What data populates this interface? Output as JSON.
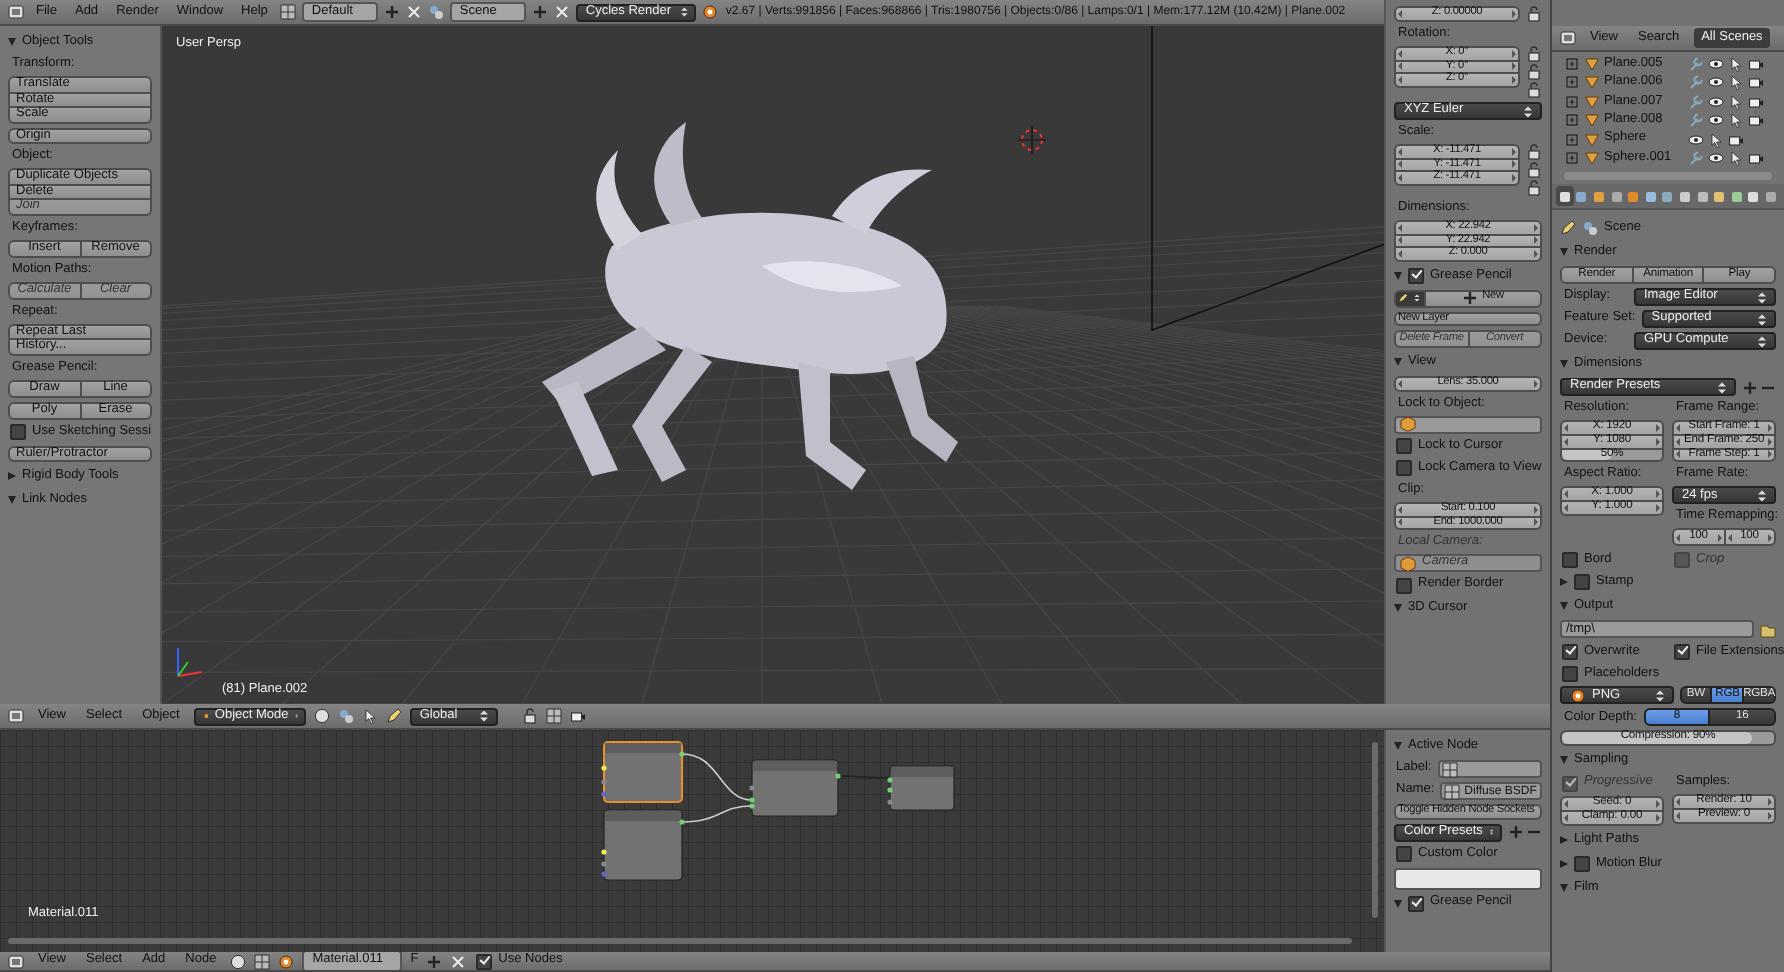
{
  "info_header": {
    "menus": [
      "File",
      "Add",
      "Render",
      "Window",
      "Help"
    ],
    "layout": "Default",
    "scene": "Scene",
    "engine": "Cycles Render",
    "stats": "v2.67 | Verts:991856 | Faces:968866 | Tris:1980756 | Objects:0/86 | Lamps:0/1 | Mem:177.12M (10.42M) | Plane.002"
  },
  "tool_shelf": [
    {
      "kind": "heading",
      "text": "Object Tools",
      "expanded": true
    },
    {
      "kind": "label",
      "text": "Transform:"
    },
    {
      "kind": "stack",
      "items": [
        {
          "kind": "button",
          "text": "Translate"
        },
        {
          "kind": "button",
          "text": "Rotate"
        },
        {
          "kind": "button",
          "text": "Scale"
        }
      ]
    },
    {
      "kind": "stack",
      "items": [
        {
          "kind": "button",
          "text": "Origin"
        }
      ]
    },
    {
      "kind": "label",
      "text": "Object:"
    },
    {
      "kind": "stack",
      "items": [
        {
          "kind": "button",
          "text": "Duplicate Objects"
        },
        {
          "kind": "button",
          "text": "Delete"
        },
        {
          "kind": "button",
          "text": "Join",
          "disabled": true
        }
      ]
    },
    {
      "kind": "label",
      "text": "Keyframes:"
    },
    {
      "kind": "row",
      "items": [
        {
          "kind": "button",
          "text": "Insert"
        },
        {
          "kind": "button",
          "text": "Remove"
        }
      ]
    },
    {
      "kind": "label",
      "text": "Motion Paths:"
    },
    {
      "kind": "row",
      "items": [
        {
          "kind": "button",
          "text": "Calculate",
          "disabled": true
        },
        {
          "kind": "button",
          "text": "Clear",
          "disabled": true
        }
      ]
    },
    {
      "kind": "label",
      "text": "Repeat:"
    },
    {
      "kind": "stack",
      "items": [
        {
          "kind": "button",
          "text": "Repeat Last"
        },
        {
          "kind": "button",
          "text": "History..."
        }
      ]
    },
    {
      "kind": "label",
      "text": "Grease Pencil:"
    },
    {
      "kind": "row",
      "items": [
        {
          "kind": "button",
          "text": "Draw"
        },
        {
          "kind": "button",
          "text": "Line"
        }
      ]
    },
    {
      "kind": "row",
      "items": [
        {
          "kind": "button",
          "text": "Poly"
        },
        {
          "kind": "button",
          "text": "Erase"
        }
      ]
    },
    {
      "kind": "check",
      "text": "Use Sketching Sessi",
      "checked": false
    },
    {
      "kind": "stack",
      "items": [
        {
          "kind": "button",
          "text": "Ruler/Protractor"
        }
      ]
    },
    {
      "kind": "heading",
      "text": "Rigid Body Tools",
      "expanded": false
    },
    {
      "kind": "heading",
      "text": "Link Nodes",
      "expanded": true
    }
  ],
  "viewport": {
    "view_label": "User Persp",
    "object_label": "(81) Plane.002"
  },
  "view_properties": [
    {
      "kind": "stack",
      "locks": true,
      "items": [
        {
          "kind": "number",
          "text": "Z: 0.00000"
        }
      ]
    },
    {
      "kind": "label",
      "text": "Rotation:"
    },
    {
      "kind": "stack",
      "locks": true,
      "items": [
        {
          "kind": "number",
          "text": "X: 0°"
        },
        {
          "kind": "number",
          "text": "Y: 0°"
        },
        {
          "kind": "number",
          "text": "Z: 0°"
        }
      ]
    },
    {
      "kind": "select",
      "value": "XYZ Euler"
    },
    {
      "kind": "label",
      "text": "Scale:"
    },
    {
      "kind": "stack",
      "locks": true,
      "items": [
        {
          "kind": "number",
          "text": "X: -11.471"
        },
        {
          "kind": "number",
          "text": "Y: -11.471"
        },
        {
          "kind": "number",
          "text": "Z: -11.471"
        }
      ]
    },
    {
      "kind": "label",
      "text": "Dimensions:"
    },
    {
      "kind": "stack",
      "items": [
        {
          "kind": "number",
          "text": "X: 22.942"
        },
        {
          "kind": "number",
          "text": "Y: 22.942"
        },
        {
          "kind": "number",
          "text": "Z: 0.000"
        }
      ]
    },
    {
      "kind": "heading",
      "text": "Grease Pencil",
      "expanded": true,
      "checked": true
    },
    {
      "kind": "row",
      "items": [
        {
          "kind": "pencil"
        },
        {
          "kind": "add",
          "text": "New"
        }
      ]
    },
    {
      "kind": "stack",
      "items": [
        {
          "kind": "button",
          "text": "New Layer"
        }
      ]
    },
    {
      "kind": "row",
      "items": [
        {
          "kind": "button",
          "text": "Delete Frame",
          "disabled": true
        },
        {
          "kind": "button",
          "text": "Convert",
          "disabled": true
        }
      ]
    },
    {
      "kind": "heading",
      "text": "View",
      "expanded": true
    },
    {
      "kind": "stack",
      "items": [
        {
          "kind": "number",
          "text": "Lens: 35.000"
        }
      ]
    },
    {
      "kind": "label",
      "text": "Lock to Object:"
    },
    {
      "kind": "object-field"
    },
    {
      "kind": "check",
      "text": "Lock to Cursor",
      "checked": false
    },
    {
      "kind": "check",
      "text": "Lock Camera to View",
      "checked": false
    },
    {
      "kind": "label",
      "text": "Clip:"
    },
    {
      "kind": "stack",
      "items": [
        {
          "kind": "number",
          "text": "Start: 0.100"
        },
        {
          "kind": "number",
          "text": "End: 1000.000"
        }
      ]
    },
    {
      "kind": "label",
      "text": "Local Camera:",
      "disabled": true
    },
    {
      "kind": "object-field",
      "value": "Camera",
      "disabled": true
    },
    {
      "kind": "check",
      "text": "Render Border",
      "checked": false
    },
    {
      "kind": "heading",
      "text": "3D Cursor",
      "expanded": true
    }
  ],
  "viewport_header": {
    "menus": [
      "View",
      "Select",
      "Object"
    ],
    "mode": "Object Mode",
    "orientation": "Global"
  },
  "node_editor": {
    "material_label": "Material.011"
  },
  "node_properties": [
    {
      "kind": "heading",
      "text": "Active Node",
      "expanded": true
    },
    {
      "kind": "labeled-field",
      "label": "Label:"
    },
    {
      "kind": "labeled-field",
      "label": "Name:",
      "value": "Diffuse BSDF"
    },
    {
      "kind": "stack",
      "items": [
        {
          "kind": "button",
          "text": "Toggle Hidden Node Sockets"
        }
      ]
    },
    {
      "kind": "preset-select",
      "value": "Color Presets"
    },
    {
      "kind": "check",
      "text": "Custom Color",
      "checked": false
    },
    {
      "kind": "swatch"
    },
    {
      "kind": "heading",
      "text": "Grease Pencil",
      "expanded": true,
      "checked": true
    }
  ],
  "node_header": {
    "menus": [
      "View",
      "Select",
      "Add",
      "Node"
    ],
    "material": "Material.011",
    "fake_user": "F",
    "use_nodes": {
      "text": "Use Nodes",
      "checked": true
    }
  },
  "outliner": {
    "menus": [
      "View",
      "Search"
    ],
    "filter": "All Scenes",
    "items": [
      "Plane.005",
      "Plane.006",
      "Plane.007",
      "Plane.008",
      "Sphere",
      "Sphere.001"
    ]
  },
  "properties_tabs": [
    {
      "selected": true
    },
    {
      "selected": false
    },
    {
      "selected": false
    },
    {
      "selected": false
    },
    {
      "selected": false
    },
    {
      "selected": false
    },
    {
      "selected": false
    },
    {
      "selected": false
    },
    {
      "selected": false
    },
    {
      "selected": false
    },
    {
      "selected": false
    },
    {
      "selected": false
    },
    {
      "selected": false
    }
  ],
  "properties_context": "Scene",
  "properties": [
    {
      "kind": "heading",
      "text": "Render",
      "expanded": true
    },
    {
      "kind": "row",
      "items": [
        {
          "kind": "button",
          "text": "Render"
        },
        {
          "kind": "button",
          "text": "Animation"
        },
        {
          "kind": "button",
          "text": "Play"
        }
      ]
    },
    {
      "kind": "select",
      "label": "Display:",
      "value": "Image Editor"
    },
    {
      "kind": "select",
      "label": "Feature Set:",
      "value": "Supported"
    },
    {
      "kind": "select",
      "label": "Device:",
      "value": "GPU Compute"
    },
    {
      "kind": "heading",
      "text": "Dimensions",
      "expanded": true
    },
    {
      "kind": "preset-select",
      "value": "Render Presets"
    },
    {
      "kind": "cols",
      "columns": [
        [
          {
            "kind": "label",
            "text": "Resolution:"
          },
          {
            "kind": "stack",
            "items": [
              {
                "kind": "number",
                "text": "X: 1920"
              },
              {
                "kind": "number",
                "text": "Y: 1080"
              },
              {
                "kind": "slider",
                "text": "50%",
                "level": 0.5
              }
            ]
          },
          {
            "kind": "label",
            "text": "Aspect Ratio:"
          },
          {
            "kind": "stack",
            "items": [
              {
                "kind": "number",
                "text": "X: 1.000"
              },
              {
                "kind": "number",
                "text": "Y: 1.000"
              }
            ]
          }
        ],
        [
          {
            "kind": "label",
            "text": "Frame Range:"
          },
          {
            "kind": "stack",
            "items": [
              {
                "kind": "number",
                "text": "Start Frame: 1"
              },
              {
                "kind": "number",
                "text": "End Frame: 250"
              },
              {
                "kind": "number",
                "text": "Frame Step: 1"
              }
            ]
          },
          {
            "kind": "label",
            "text": "Frame Rate:"
          },
          {
            "kind": "select",
            "value": "24 fps"
          },
          {
            "kind": "label",
            "text": "Time Remapping:"
          },
          {
            "kind": "row",
            "items": [
              {
                "kind": "number",
                "text": "100"
              },
              {
                "kind": "number",
                "text": "100"
              }
            ]
          }
        ]
      ]
    },
    {
      "kind": "checks",
      "items": [
        {
          "text": "Bord",
          "checked": false
        },
        {
          "text": "Crop",
          "checked": false,
          "disabled": true
        }
      ]
    },
    {
      "kind": "heading",
      "text": "Stamp",
      "expanded": false,
      "checked": false
    },
    {
      "kind": "heading",
      "text": "Output",
      "expanded": true
    },
    {
      "kind": "path-field",
      "value": "/tmp\\"
    },
    {
      "kind": "checks",
      "items": [
        {
          "text": "Overwrite",
          "checked": true
        },
        {
          "text": "File Extensions",
          "checked": true
        }
      ]
    },
    {
      "kind": "check",
      "text": "Placeholders",
      "checked": false
    },
    {
      "kind": "format-row",
      "value": "PNG",
      "items": [
        {
          "kind": "toggle",
          "text": "BW",
          "selected": false
        },
        {
          "kind": "toggle",
          "text": "RGB",
          "selected": true
        },
        {
          "kind": "toggle",
          "text": "RGBA",
          "selected": false
        }
      ]
    },
    {
      "kind": "labeled-row",
      "label": "Color Depth:",
      "items": [
        {
          "kind": "toggle",
          "text": "8",
          "selected": true
        },
        {
          "kind": "toggle",
          "text": "16",
          "selected": false
        }
      ]
    },
    {
      "kind": "stack",
      "items": [
        {
          "kind": "slider",
          "text": "Compression: 90%",
          "level": 0.9
        }
      ]
    },
    {
      "kind": "heading",
      "text": "Sampling",
      "expanded": true
    },
    {
      "kind": "cols",
      "columns": [
        [
          {
            "kind": "check",
            "text": "Progressive",
            "checked": true,
            "disabled": true
          },
          {
            "kind": "stack",
            "items": [
              {
                "kind": "number",
                "text": "Seed: 0"
              },
              {
                "kind": "number",
                "text": "Clamp: 0.00"
              }
            ]
          }
        ],
        [
          {
            "kind": "label",
            "text": "Samples:"
          },
          {
            "kind": "stack",
            "items": [
              {
                "kind": "number",
                "text": "Render: 10"
              },
              {
                "kind": "number",
                "text": "Preview: 0"
              }
            ]
          }
        ]
      ]
    },
    {
      "kind": "heading",
      "text": "Light Paths",
      "expanded": false
    },
    {
      "kind": "heading",
      "text": "Motion Blur",
      "expanded": false,
      "checked": false
    },
    {
      "kind": "heading",
      "text": "Film",
      "expanded": true
    }
  ]
}
